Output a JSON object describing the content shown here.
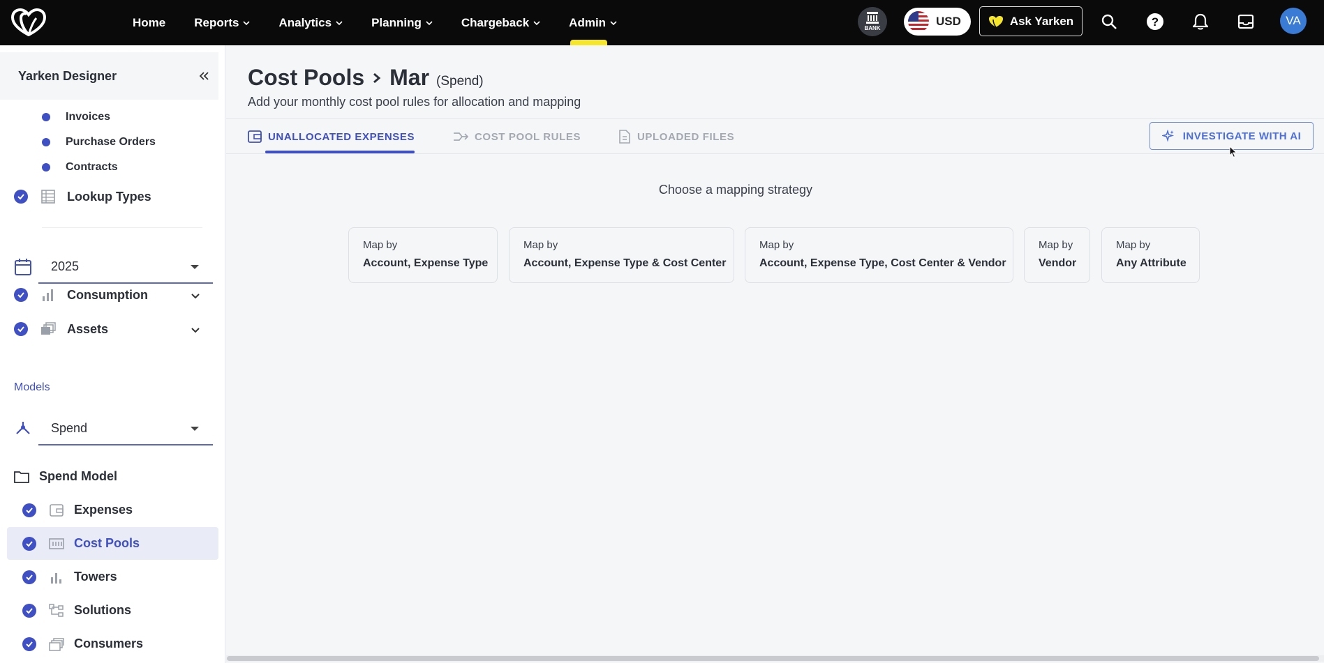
{
  "topbar": {
    "nav": [
      {
        "label": "Home",
        "has_dropdown": false
      },
      {
        "label": "Reports",
        "has_dropdown": true
      },
      {
        "label": "Analytics",
        "has_dropdown": true
      },
      {
        "label": "Planning",
        "has_dropdown": true
      },
      {
        "label": "Chargeback",
        "has_dropdown": true
      },
      {
        "label": "Admin",
        "has_dropdown": true
      }
    ],
    "bank_label": "BANK",
    "currency": "USD",
    "ask_label": "Ask Yarken",
    "avatar_initials": "VA",
    "icons": [
      "search-icon",
      "help-icon",
      "bell-icon",
      "inbox-icon"
    ]
  },
  "sidebar": {
    "header": "Yarken Designer",
    "sub_items": [
      "Invoices",
      "Purchase Orders",
      "Contracts"
    ],
    "lookup_types": "Lookup Types",
    "year": "2025",
    "consumption": "Consumption",
    "assets": "Assets",
    "models_label": "Models",
    "model_select": "Spend",
    "folder": "Spend Model",
    "tree": [
      {
        "label": "Expenses",
        "icon": "wallet-icon",
        "active": false
      },
      {
        "label": "Cost Pools",
        "icon": "cost-pool-icon",
        "active": true
      },
      {
        "label": "Towers",
        "icon": "bar-chart-icon",
        "active": false
      },
      {
        "label": "Solutions",
        "icon": "hierarchy-icon",
        "active": false
      },
      {
        "label": "Consumers",
        "icon": "layers-icon",
        "active": false
      }
    ]
  },
  "main": {
    "title_root": "Cost Pools",
    "title_leaf": "Mar",
    "title_suffix": "(Spend)",
    "subtitle": "Add your monthly cost pool rules for allocation and mapping",
    "tabs": [
      {
        "label": "UNALLOCATED EXPENSES",
        "active": true
      },
      {
        "label": "COST POOL RULES",
        "active": false
      },
      {
        "label": "UPLOADED FILES",
        "active": false
      }
    ],
    "ai_button": "INVESTIGATE WITH AI",
    "strategy_title": "Choose a mapping strategy",
    "strategies": [
      {
        "prefix": "Map by",
        "label": "Account, Expense Type"
      },
      {
        "prefix": "Map by",
        "label": "Account, Expense Type & Cost Center"
      },
      {
        "prefix": "Map by",
        "label": "Account, Expense Type, Cost Center & Vendor"
      },
      {
        "prefix": "Map by",
        "label": "Vendor"
      },
      {
        "prefix": "Map by",
        "label": "Any Attribute"
      }
    ]
  },
  "colors": {
    "accent": "#3f4fc4",
    "topbar_bg": "#0a0a0a",
    "ai_accent": "#4c6ed6"
  }
}
